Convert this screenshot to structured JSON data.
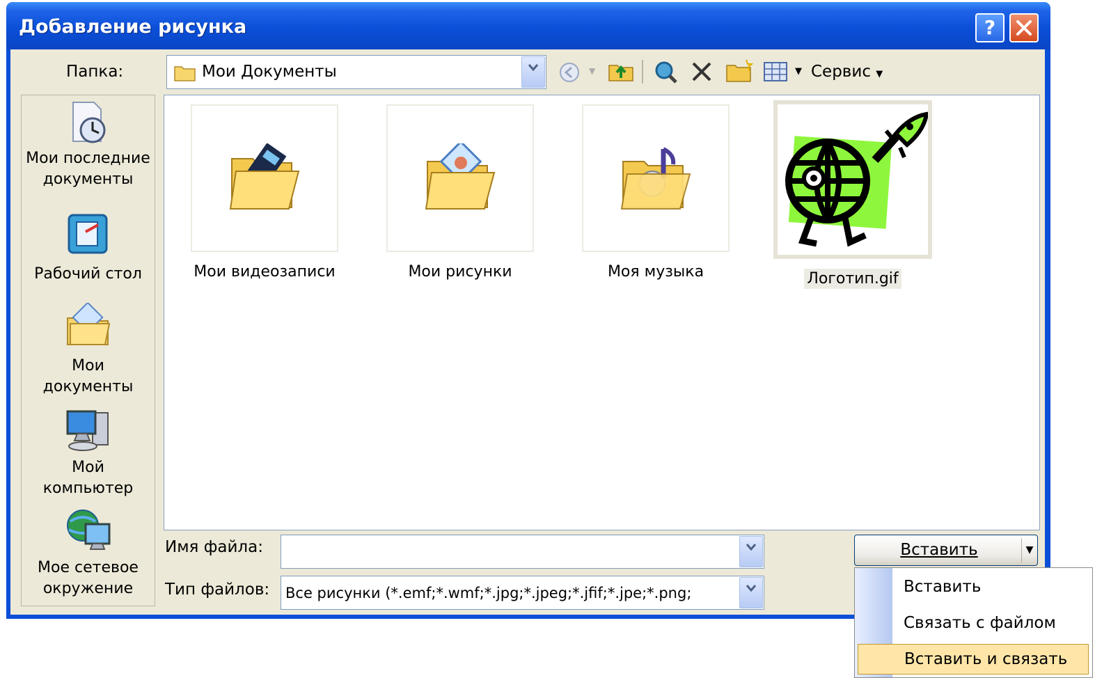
{
  "window": {
    "title": "Добавление рисунка",
    "help_label": "?",
    "close_label": "×"
  },
  "lookin": {
    "label": "Папка:",
    "value": "Мои Документы"
  },
  "toolbar": {
    "tools_label": "Сервис",
    "icons": [
      "back-icon",
      "up-folder-icon",
      "search-web-icon",
      "delete-icon",
      "new-folder-icon",
      "views-icon"
    ]
  },
  "places": [
    {
      "label": "Мои последние документы",
      "icon": "recent-documents-icon"
    },
    {
      "label": "Рабочий стол",
      "icon": "desktop-icon"
    },
    {
      "label": "Мои документы",
      "icon": "my-documents-icon"
    },
    {
      "label": "Мой компьютер",
      "icon": "my-computer-icon"
    },
    {
      "label": "Мое сетевое окружение",
      "icon": "network-places-icon"
    }
  ],
  "files": [
    {
      "label": "Мои видеозаписи",
      "icon": "video-folder-icon"
    },
    {
      "label": "Мои рисунки",
      "icon": "pictures-folder-icon"
    },
    {
      "label": "Моя музыка",
      "icon": "music-folder-icon"
    },
    {
      "label": "Логотип.gif",
      "icon": "logo-globe-image",
      "selected": true
    }
  ],
  "filename": {
    "label": "Имя файла:",
    "value": ""
  },
  "filetype": {
    "label": "Тип файлов:",
    "value": "Все рисунки (*.emf;*.wmf;*.jpg;*.jpeg;*.jfif;*.jpe;*.png;"
  },
  "insert_button": {
    "label": "Вставить"
  },
  "insert_menu": {
    "items": [
      "Вставить",
      "Связать с файлом",
      "Вставить и связать"
    ],
    "highlighted_index": 2
  },
  "colors": {
    "title_bar": "#0b4fd8",
    "dialog_bg": "#ece9d8",
    "menu_highlight": "#ffe6a8"
  }
}
